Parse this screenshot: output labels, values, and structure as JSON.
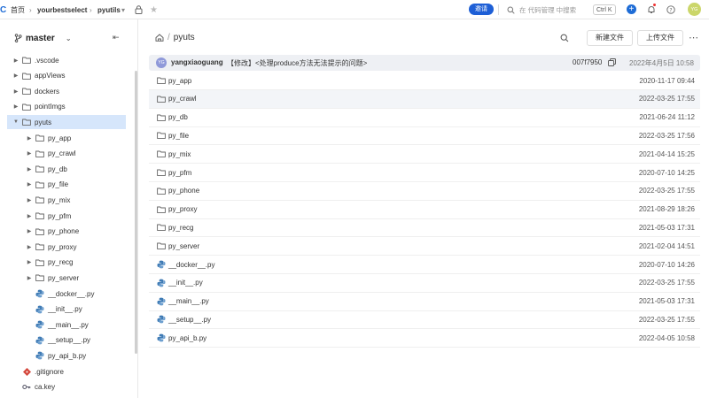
{
  "topbar": {
    "breadcrumb": [
      "首页",
      "yourbestselect",
      "pyutils"
    ],
    "invite_label": "邀请",
    "search_placeholder": "在 代码管理 中搜索",
    "shortcut": "Ctrl K",
    "plus_label": "+",
    "avatar_initials": "YG",
    "colors": {
      "accent": "#1e6cd6",
      "avatar": "#cbd66a"
    }
  },
  "sidebar": {
    "branch": "master",
    "tree": [
      {
        "label": ".vscode",
        "type": "folder",
        "depth": 0,
        "caret": true
      },
      {
        "label": "appViews",
        "type": "folder",
        "depth": 0,
        "caret": true
      },
      {
        "label": "dockers",
        "type": "folder",
        "depth": 0,
        "caret": true
      },
      {
        "label": "pointImgs",
        "type": "folder",
        "depth": 0,
        "caret": true
      },
      {
        "label": "pyuts",
        "type": "folder",
        "depth": 0,
        "caret": true,
        "open": true,
        "selected": true
      },
      {
        "label": "py_app",
        "type": "folder",
        "depth": 1,
        "caret": true
      },
      {
        "label": "py_crawl",
        "type": "folder",
        "depth": 1,
        "caret": true
      },
      {
        "label": "py_db",
        "type": "folder",
        "depth": 1,
        "caret": true
      },
      {
        "label": "py_file",
        "type": "folder",
        "depth": 1,
        "caret": true
      },
      {
        "label": "py_mix",
        "type": "folder",
        "depth": 1,
        "caret": true
      },
      {
        "label": "py_pfm",
        "type": "folder",
        "depth": 1,
        "caret": true
      },
      {
        "label": "py_phone",
        "type": "folder",
        "depth": 1,
        "caret": true
      },
      {
        "label": "py_proxy",
        "type": "folder",
        "depth": 1,
        "caret": true
      },
      {
        "label": "py_recg",
        "type": "folder",
        "depth": 1,
        "caret": true
      },
      {
        "label": "py_server",
        "type": "folder",
        "depth": 1,
        "caret": true
      },
      {
        "label": "__docker__.py",
        "type": "python",
        "depth": 1,
        "caret": false
      },
      {
        "label": "__init__.py",
        "type": "python",
        "depth": 1,
        "caret": false
      },
      {
        "label": "__main__.py",
        "type": "python",
        "depth": 1,
        "caret": false
      },
      {
        "label": "__setup__.py",
        "type": "python",
        "depth": 1,
        "caret": false
      },
      {
        "label": "py_api_b.py",
        "type": "python",
        "depth": 1,
        "caret": false
      },
      {
        "label": ".gitignore",
        "type": "git",
        "depth": 0,
        "caret": false
      },
      {
        "label": "ca.key",
        "type": "key",
        "depth": 0,
        "caret": false
      }
    ]
  },
  "main": {
    "path_current": "pyuts",
    "path_sep": "/",
    "new_file_label": "新建文件",
    "upload_label": "上传文件",
    "more_label": "⋯",
    "commit": {
      "avatar": "YG",
      "author": "yangxiaoguang",
      "message": "【修改】<处理produce方法无法提示的问题>",
      "hash": "007f7950",
      "date": "2022年4月5日 10:58"
    },
    "files": [
      {
        "name": "py_app",
        "type": "folder",
        "date": "2020-11-17 09:44"
      },
      {
        "name": "py_crawl",
        "type": "folder",
        "date": "2022-03-25 17:55"
      },
      {
        "name": "py_db",
        "type": "folder",
        "date": "2021-06-24 11:12"
      },
      {
        "name": "py_file",
        "type": "folder",
        "date": "2022-03-25 17:56"
      },
      {
        "name": "py_mix",
        "type": "folder",
        "date": "2021-04-14 15:25"
      },
      {
        "name": "py_pfm",
        "type": "folder",
        "date": "2020-07-10 14:25"
      },
      {
        "name": "py_phone",
        "type": "folder",
        "date": "2022-03-25 17:55"
      },
      {
        "name": "py_proxy",
        "type": "folder",
        "date": "2021-08-29 18:26"
      },
      {
        "name": "py_recg",
        "type": "folder",
        "date": "2021-05-03 17:31"
      },
      {
        "name": "py_server",
        "type": "folder",
        "date": "2021-02-04 14:51"
      },
      {
        "name": "__docker__.py",
        "type": "python",
        "date": "2020-07-10 14:26"
      },
      {
        "name": "__init__.py",
        "type": "python",
        "date": "2022-03-25 17:55"
      },
      {
        "name": "__main__.py",
        "type": "python",
        "date": "2021-05-03 17:31"
      },
      {
        "name": "__setup__.py",
        "type": "python",
        "date": "2022-03-25 17:55"
      },
      {
        "name": "py_api_b.py",
        "type": "python",
        "date": "2022-04-05 10:58"
      }
    ]
  }
}
